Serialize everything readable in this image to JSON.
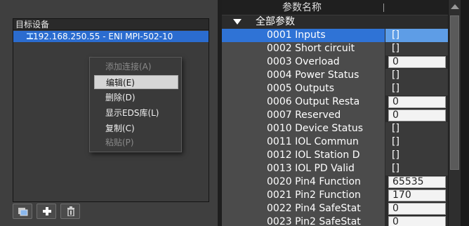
{
  "device_tree": {
    "header": "目标设备",
    "node_label": "192.168.250.55 - ENI MPI-502-10"
  },
  "context_menu": {
    "items": [
      {
        "label": "添加连接(A)",
        "enabled": false
      },
      {
        "label": "编辑(E)",
        "enabled": true,
        "highlighted": true
      },
      {
        "label": "删除(D)",
        "enabled": true
      },
      {
        "label": "显示EDS库(L)",
        "enabled": true
      },
      {
        "label": "复制(C)",
        "enabled": true
      },
      {
        "label": "粘贴(P)",
        "enabled": false
      }
    ]
  },
  "toolbar": {
    "buttons": [
      {
        "icon": "device-folder-icon"
      },
      {
        "icon": "plus-icon"
      },
      {
        "icon": "trash-icon"
      }
    ]
  },
  "parameters": {
    "column_header": "参数名称",
    "group_label": "全部参数",
    "rows": [
      {
        "name": "0001 Inputs",
        "value": "[]",
        "type": "text",
        "selected": true
      },
      {
        "name": "0002 Short circuit",
        "value": "[]",
        "type": "text"
      },
      {
        "name": "0003 Overload",
        "value": "0",
        "type": "input"
      },
      {
        "name": "0004 Power Status",
        "value": "[]",
        "type": "text"
      },
      {
        "name": "0005 Outputs",
        "value": "[]",
        "type": "text"
      },
      {
        "name": "0006 Output Resta",
        "value": "0",
        "type": "input"
      },
      {
        "name": "0007 Reserved",
        "value": "0",
        "type": "input"
      },
      {
        "name": "0010 Device Status",
        "value": "[]",
        "type": "text"
      },
      {
        "name": "0011 IOL Commun",
        "value": "[]",
        "type": "text"
      },
      {
        "name": "0012 IOL Station D",
        "value": "[]",
        "type": "text"
      },
      {
        "name": "0013 IOL PD Valid",
        "value": "[]",
        "type": "text"
      },
      {
        "name": "0020 Pin4 Function",
        "value": "65535",
        "type": "input"
      },
      {
        "name": "0021 Pin2 Function",
        "value": "170",
        "type": "input"
      },
      {
        "name": "0022 Pin4 SafeStat",
        "value": "0",
        "type": "input"
      },
      {
        "name": "0023 Pin2 SafeStat",
        "value": "0",
        "type": "input"
      }
    ]
  },
  "colors": {
    "selection": "#2b6ccf",
    "row_bg": "#4b4b4b",
    "input_bg": "#f3f3f3"
  }
}
